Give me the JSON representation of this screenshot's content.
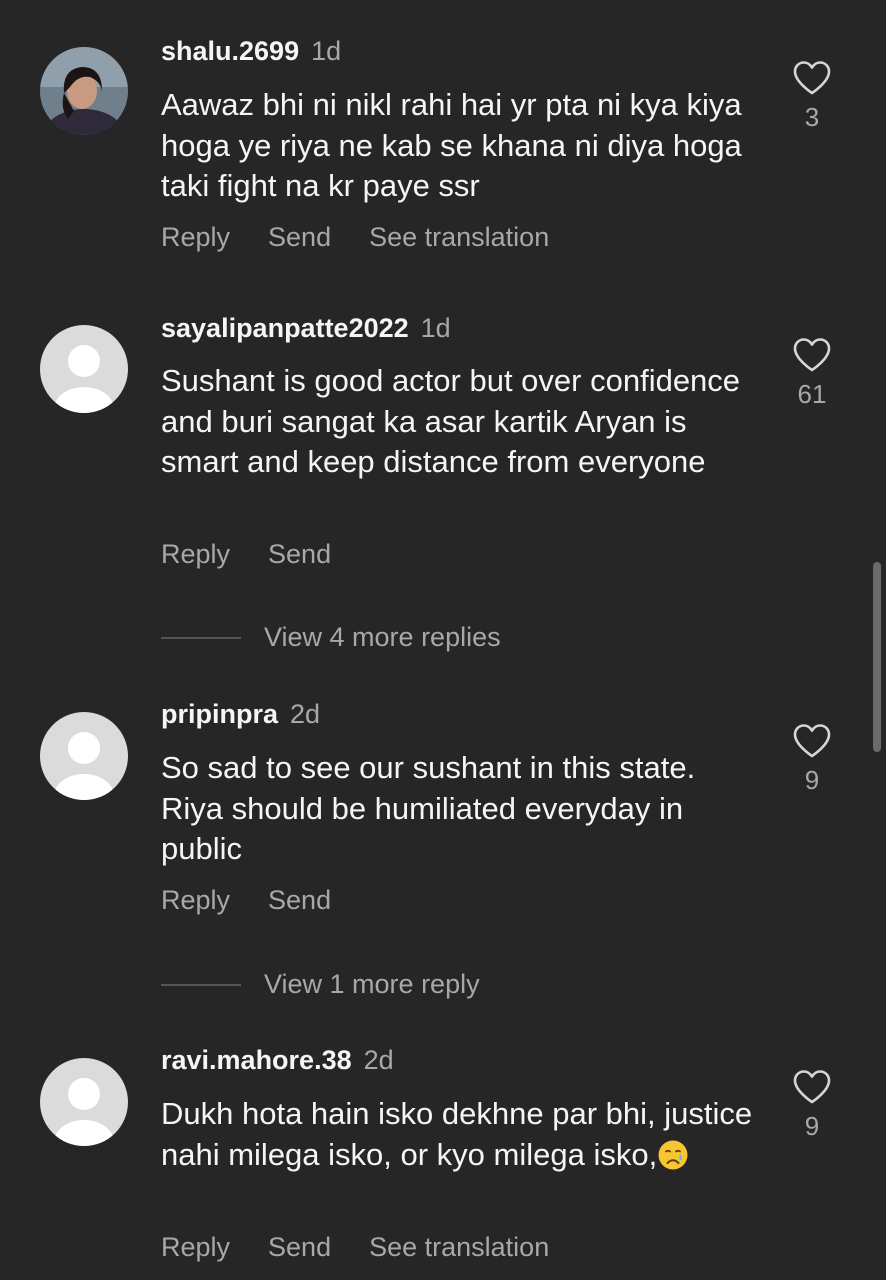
{
  "comments": [
    {
      "username": "shalu.2699",
      "time": "1d",
      "text": "Aawaz bhi ni nikl rahi hai yr pta ni kya kiya hoga ye riya ne kab se khana ni diya hoga taki fight na kr paye ssr",
      "likes": "3",
      "reply_label": "Reply",
      "send_label": "Send",
      "translate_label": "See translation",
      "has_photo": true
    },
    {
      "username": "sayalipanpatte2022",
      "time": "1d",
      "text": "Sushant is good actor but over confidence and buri sangat ka asar kartik Aryan is smart and keep distance from everyone",
      "likes": "61",
      "reply_label": "Reply",
      "send_label": "Send",
      "view_replies": "View 4 more replies"
    },
    {
      "username": "pripinpra",
      "time": "2d",
      "text": "So sad to see our sushant in this state. Riya should be humiliated everyday in public",
      "likes": "9",
      "reply_label": "Reply",
      "send_label": "Send",
      "view_replies": "View 1 more reply"
    },
    {
      "username": "ravi.mahore.38",
      "time": "2d",
      "text": "Dukh hota hain isko dekhne par bhi, justice nahi milega isko, or kyo milega isko,",
      "emoji": "crying-face-emoji",
      "likes": "9",
      "reply_label": "Reply",
      "send_label": "Send",
      "translate_label": "See translation"
    }
  ],
  "colors": {
    "background": "#262626",
    "primary_text": "#f5f5f5",
    "secondary_text": "#a8a8a8",
    "default_avatar_bg": "#dbdbdb"
  }
}
